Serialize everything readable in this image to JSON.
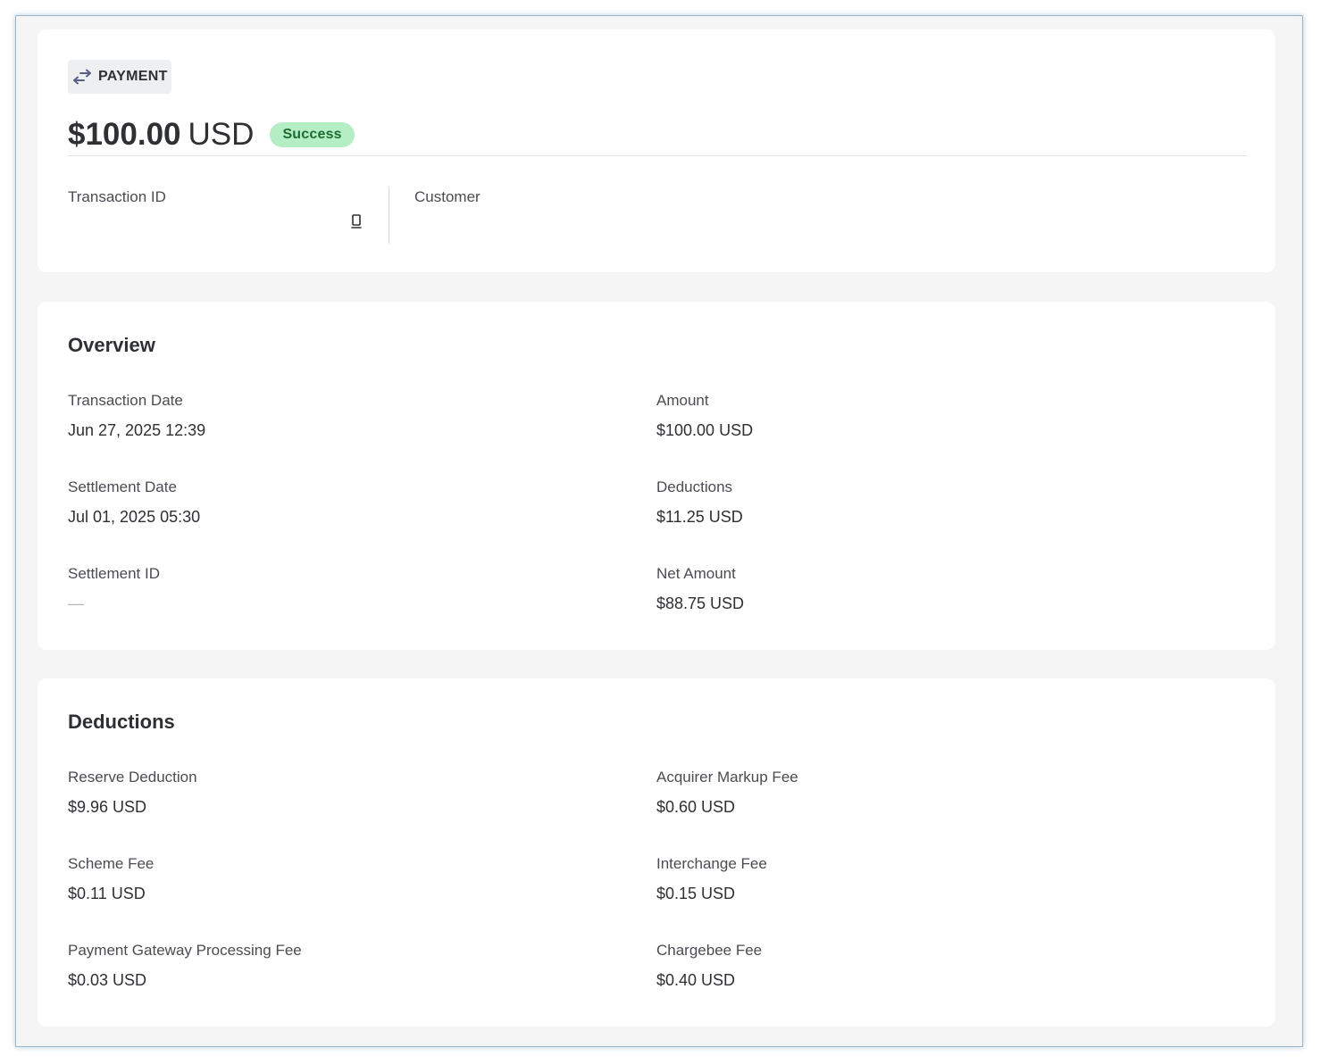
{
  "header": {
    "type_label": "PAYMENT",
    "type_icon": "swap-arrows-icon",
    "amount": "$100.00",
    "currency": "USD",
    "status": "Success",
    "status_color": "#b5eec5",
    "transaction_id_label": "Transaction ID",
    "customer_label": "Customer"
  },
  "overview": {
    "title": "Overview",
    "fields": [
      {
        "label": "Transaction Date",
        "value": "Jun 27, 2025 12:39"
      },
      {
        "label": "Amount",
        "value": "$100.00 USD"
      },
      {
        "label": "Settlement Date",
        "value": "Jul 01, 2025 05:30"
      },
      {
        "label": "Deductions",
        "value": "$11.25 USD"
      },
      {
        "label": "Settlement ID",
        "value": "—"
      },
      {
        "label": "Net Amount",
        "value": "$88.75 USD"
      }
    ]
  },
  "deductions": {
    "title": "Deductions",
    "fields": [
      {
        "label": "Reserve Deduction",
        "value": "$9.96 USD"
      },
      {
        "label": "Acquirer Markup Fee",
        "value": "$0.60 USD"
      },
      {
        "label": "Scheme Fee",
        "value": "$0.11 USD"
      },
      {
        "label": "Interchange Fee",
        "value": "$0.15 USD"
      },
      {
        "label": "Payment Gateway Processing Fee",
        "value": "$0.03 USD"
      },
      {
        "label": "Chargebee Fee",
        "value": "$0.40 USD"
      }
    ]
  }
}
